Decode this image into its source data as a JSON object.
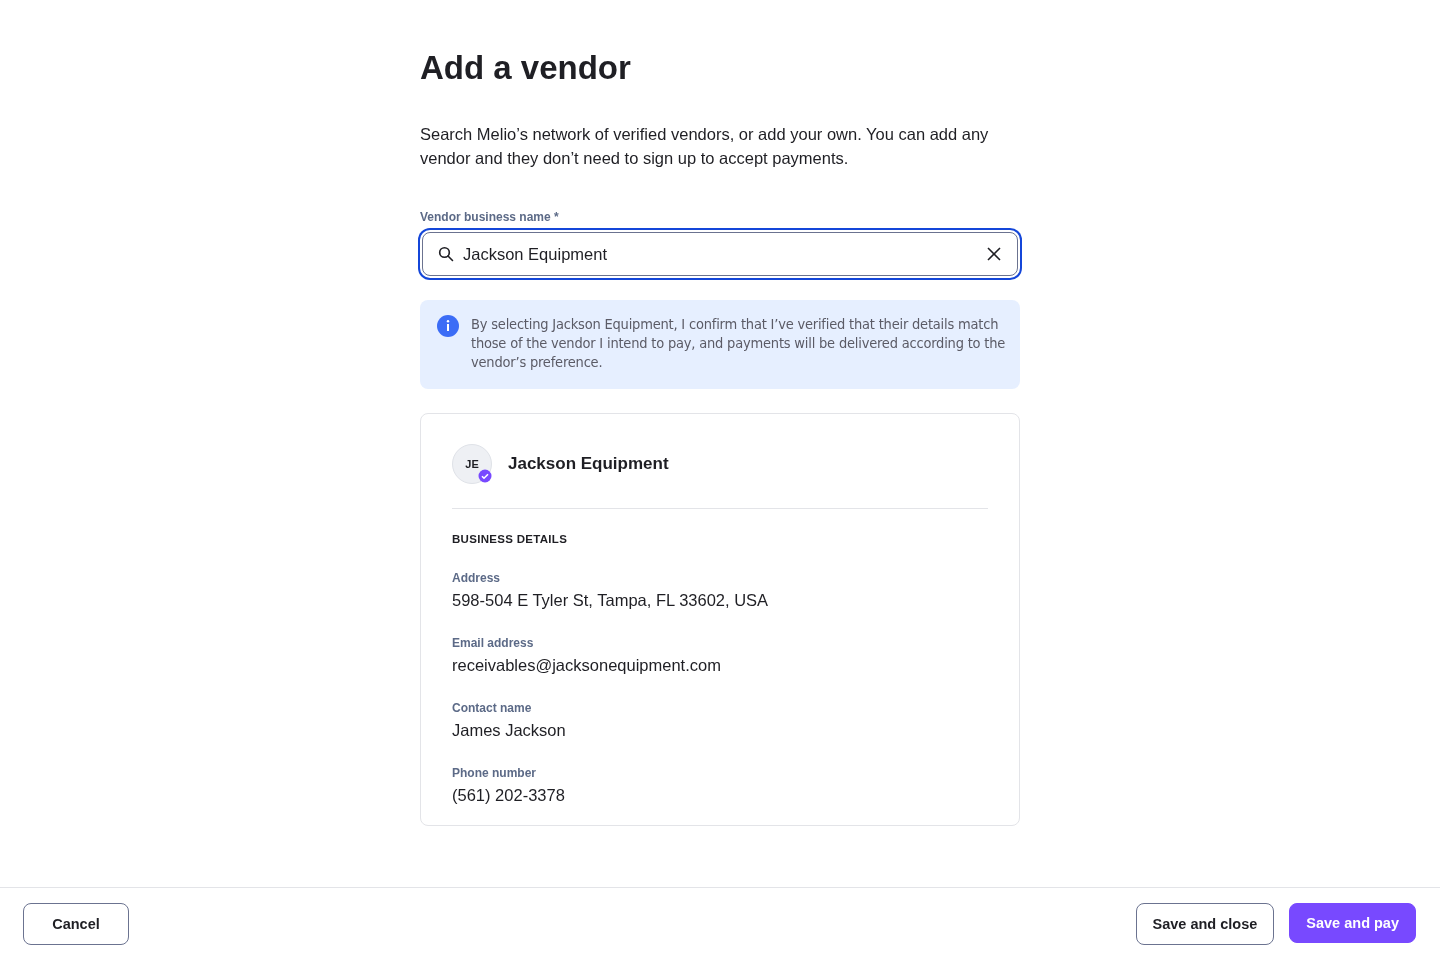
{
  "title": "Add a vendor",
  "intro": "Search Melio’s network of verified vendors, or add your own. You can add any vendor and they don’t need to sign up to accept payments.",
  "vendor_field": {
    "label": "Vendor business name *",
    "value": "Jackson Equipment"
  },
  "info": "By selecting Jackson Equipment, I confirm that I’ve verified that their details match those of the vendor I intend to pay, and payments will be delivered according to the vendor’s preference.",
  "vendor_card": {
    "initials": "JE",
    "verified": true,
    "name": "Jackson Equipment",
    "section_title": "BUSINESS DETAILS",
    "details": [
      {
        "label": "Address",
        "value": "598-504 E Tyler St, Tampa, FL 33602, USA"
      },
      {
        "label": "Email address",
        "value": "receivables@jacksonequipment.com"
      },
      {
        "label": "Contact name",
        "value": "James Jackson"
      },
      {
        "label": "Phone number",
        "value": "(561) 202-3378"
      }
    ]
  },
  "footer": {
    "cancel": "Cancel",
    "save_close": "Save and close",
    "save_pay": "Save and pay"
  }
}
